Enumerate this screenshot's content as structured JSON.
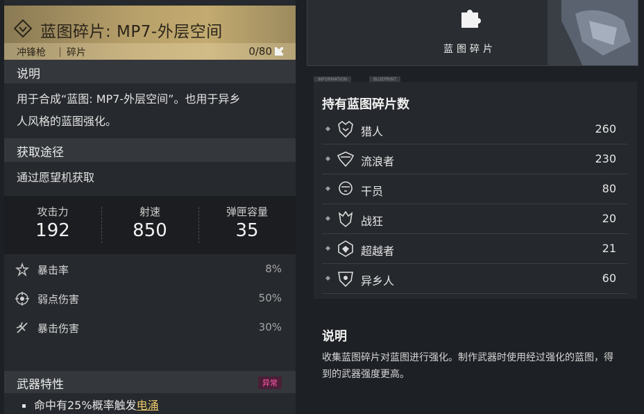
{
  "item": {
    "title": "蓝图碎片: MP7-外层空间",
    "category": "冲锋枪",
    "type": "碎片",
    "count": "0/80"
  },
  "description": {
    "heading": "说明",
    "text_line1": "用于合成“蓝图: MP7-外层空间”。也用于异乡",
    "text_line2": "人风格的蓝图强化。"
  },
  "source": {
    "heading": "获取途径",
    "text": "通过愿望机获取"
  },
  "stats": [
    {
      "label": "攻击力",
      "value": "192"
    },
    {
      "label": "射速",
      "value": "850"
    },
    {
      "label": "弹匣容量",
      "value": "35"
    }
  ],
  "attributes": [
    {
      "label": "暴击率",
      "value": "8%",
      "icon": "crit-rate-icon"
    },
    {
      "label": "弱点伤害",
      "value": "50%",
      "icon": "weakspot-icon"
    },
    {
      "label": "暴击伤害",
      "value": "30%",
      "icon": "crit-damage-icon"
    }
  ],
  "trait": {
    "heading": "武器特性",
    "badge": "异常",
    "line_prefix": "命中有25%概率触发",
    "line_link": "电涌"
  },
  "preview": {
    "label": "蓝图碎片"
  },
  "tab_chips": [
    "INFORMATION",
    "BLUEPRINT"
  ],
  "holdings": {
    "title": "持有蓝图碎片数",
    "rows": [
      {
        "name": "猎人",
        "value": "260",
        "icon": "hunter-icon"
      },
      {
        "name": "流浪者",
        "value": "230",
        "icon": "wanderer-icon"
      },
      {
        "name": "干员",
        "value": "80",
        "icon": "operator-icon"
      },
      {
        "name": "战狂",
        "value": "20",
        "icon": "berserker-icon"
      },
      {
        "name": "超越者",
        "value": "21",
        "icon": "transcender-icon"
      },
      {
        "name": "异乡人",
        "value": "60",
        "icon": "outlander-icon"
      }
    ]
  },
  "right_description": {
    "heading": "说明",
    "text": "收集蓝图碎片对蓝图进行强化。制作武器时使用经过强化的蓝图，得到的武器强度更高。"
  },
  "colors": {
    "header_gold": "#c2aa70",
    "badge_pink": "#ff5aa8",
    "link_gold": "#e8c76a"
  }
}
